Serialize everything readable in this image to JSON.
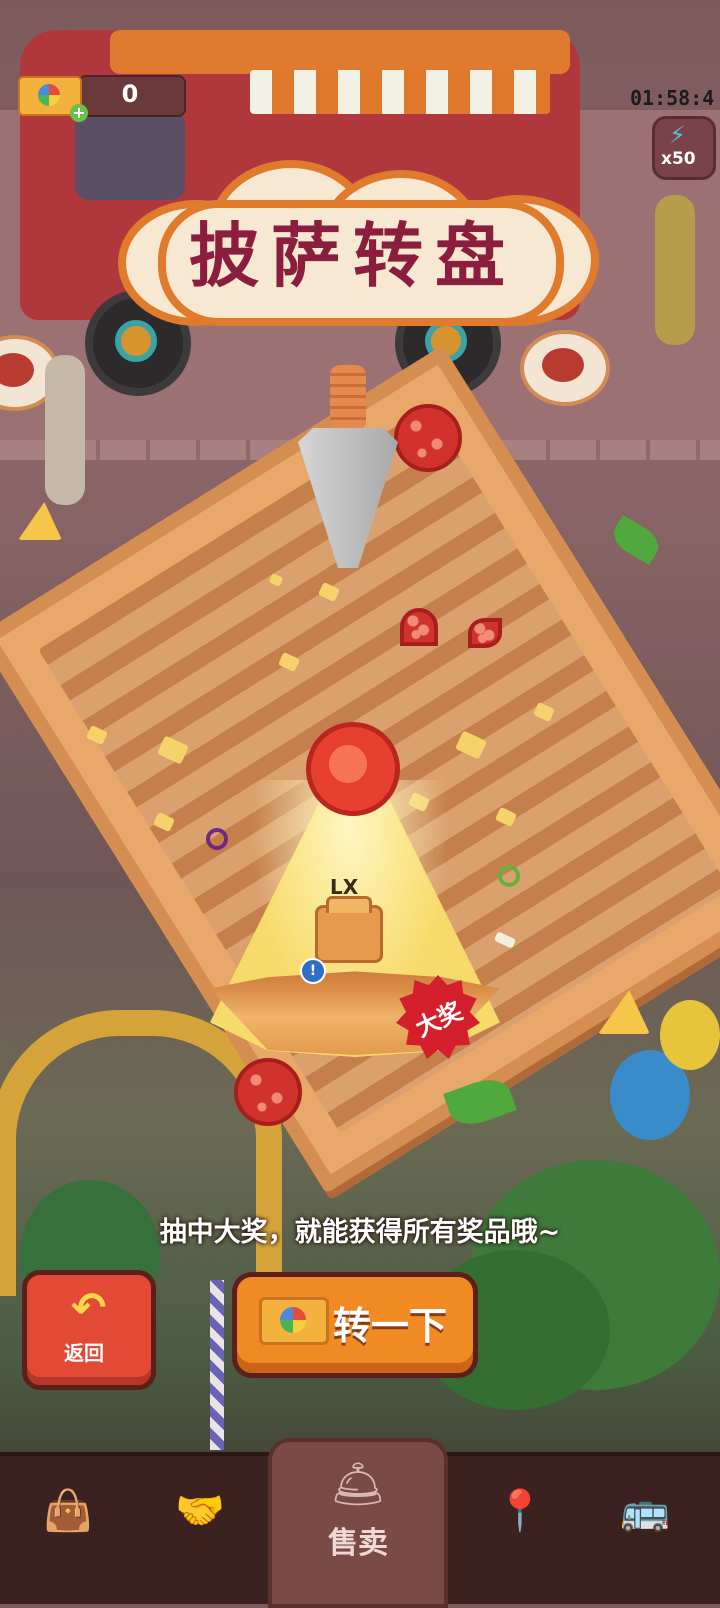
{
  "hud": {
    "ticket_count": "0",
    "timer": "01:58:4",
    "energy_count": "x50"
  },
  "title": "披萨转盘",
  "wheel": {
    "prize_label": "LX",
    "grand_prize_badge": "大奖"
  },
  "hint": "抽中大奖，就能获得所有奖品哦~",
  "buttons": {
    "back_label": "返回",
    "spin_label": "转一下"
  },
  "bottom_nav": {
    "items": [
      {
        "icon": "bag-icon"
      },
      {
        "icon": "handshake-icon"
      },
      {
        "icon": "cloche-icon",
        "label": "售卖",
        "active": true
      },
      {
        "icon": "map-pin-icon"
      },
      {
        "icon": "bus-icon"
      }
    ]
  },
  "colors": {
    "title_text": "#8b1e3f",
    "spin_button": "#f08a22",
    "back_button": "#e24a35",
    "grand_badge": "#d41f2c"
  }
}
